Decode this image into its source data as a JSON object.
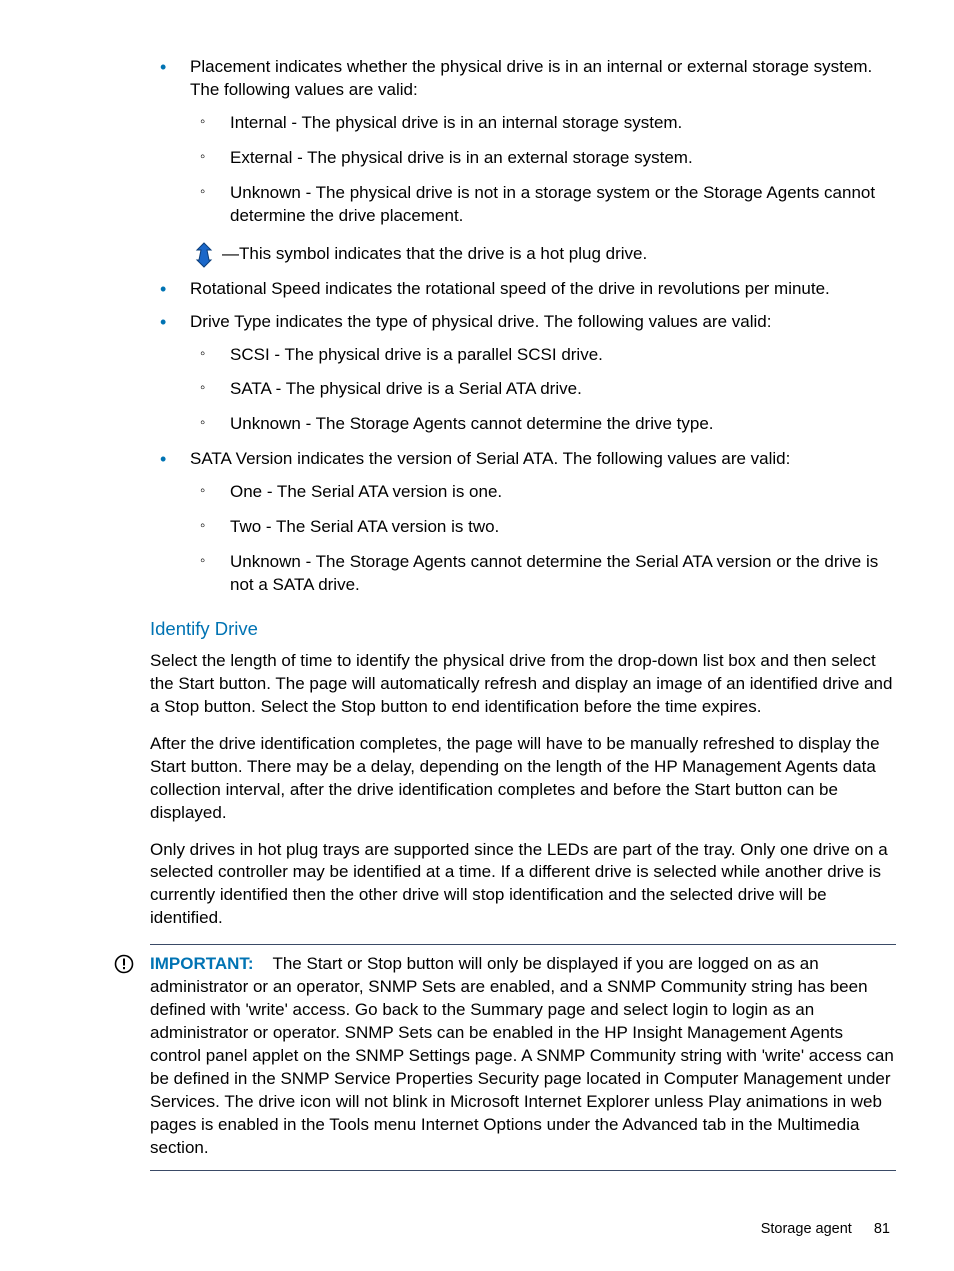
{
  "bullets": {
    "placement_intro": "Placement indicates whether the physical drive is in an internal or external storage system. The following values are valid:",
    "placement_items": {
      "internal": "Internal - The physical drive is in an internal storage system.",
      "external": "External - The physical drive is in an external storage system.",
      "unknown": "Unknown - The physical drive is not in a storage system or the Storage Agents cannot determine the drive placement."
    },
    "hotplug_text": "—This symbol indicates that the drive is a hot plug drive.",
    "rotational": "Rotational Speed indicates the rotational speed of the drive in revolutions per minute.",
    "drivetype_intro": "Drive Type indicates the type of physical drive. The following values are valid:",
    "drivetype_items": {
      "scsi": "SCSI - The physical drive is a parallel SCSI drive.",
      "sata": "SATA - The physical drive is a Serial ATA drive.",
      "unknown": "Unknown - The Storage Agents cannot determine the drive type."
    },
    "sataver_intro": "SATA Version indicates the version of Serial ATA. The following values are valid:",
    "sataver_items": {
      "one": "One - The Serial ATA version is one.",
      "two": "Two - The Serial ATA version is two.",
      "unknown": "Unknown - The Storage Agents cannot determine the Serial ATA version or the drive is not a SATA drive."
    }
  },
  "identify": {
    "heading": "Identify Drive",
    "p1": "Select the length of time to identify the physical drive from the drop-down list box and then select the Start button. The page will automatically refresh and display an image of an identified drive and a Stop button. Select the Stop button to end identification before the time expires.",
    "p2": "After the drive identification completes, the page will have to be manually refreshed to display the Start button. There may be a delay, depending on the length of the HP Management Agents data collection interval, after the drive identification completes and before the Start button can be displayed.",
    "p3": "Only drives in hot plug trays are supported since the LEDs are part of the tray. Only one drive on a selected controller may be identified at a time. If a different drive is selected while another drive is currently identified then the other drive will stop identification and the selected drive will be identified."
  },
  "important": {
    "label": "IMPORTANT:",
    "text": "The Start or Stop button will only be displayed if you are logged on as an administrator or an operator, SNMP Sets are enabled, and a SNMP Community string has been defined with 'write' access. Go back to the Summary page and select login to login as an administrator or operator. SNMP Sets can be enabled in the HP Insight Management Agents control panel applet on the SNMP Settings page. A SNMP Community string with 'write' access can be defined in the SNMP Service Properties Security page located in Computer Management under Services. The drive icon will not blink in Microsoft Internet Explorer unless Play animations in web pages is enabled in the Tools menu Internet Options under the Advanced tab in the Multimedia section."
  },
  "footer": {
    "section": "Storage agent",
    "page": "81"
  }
}
